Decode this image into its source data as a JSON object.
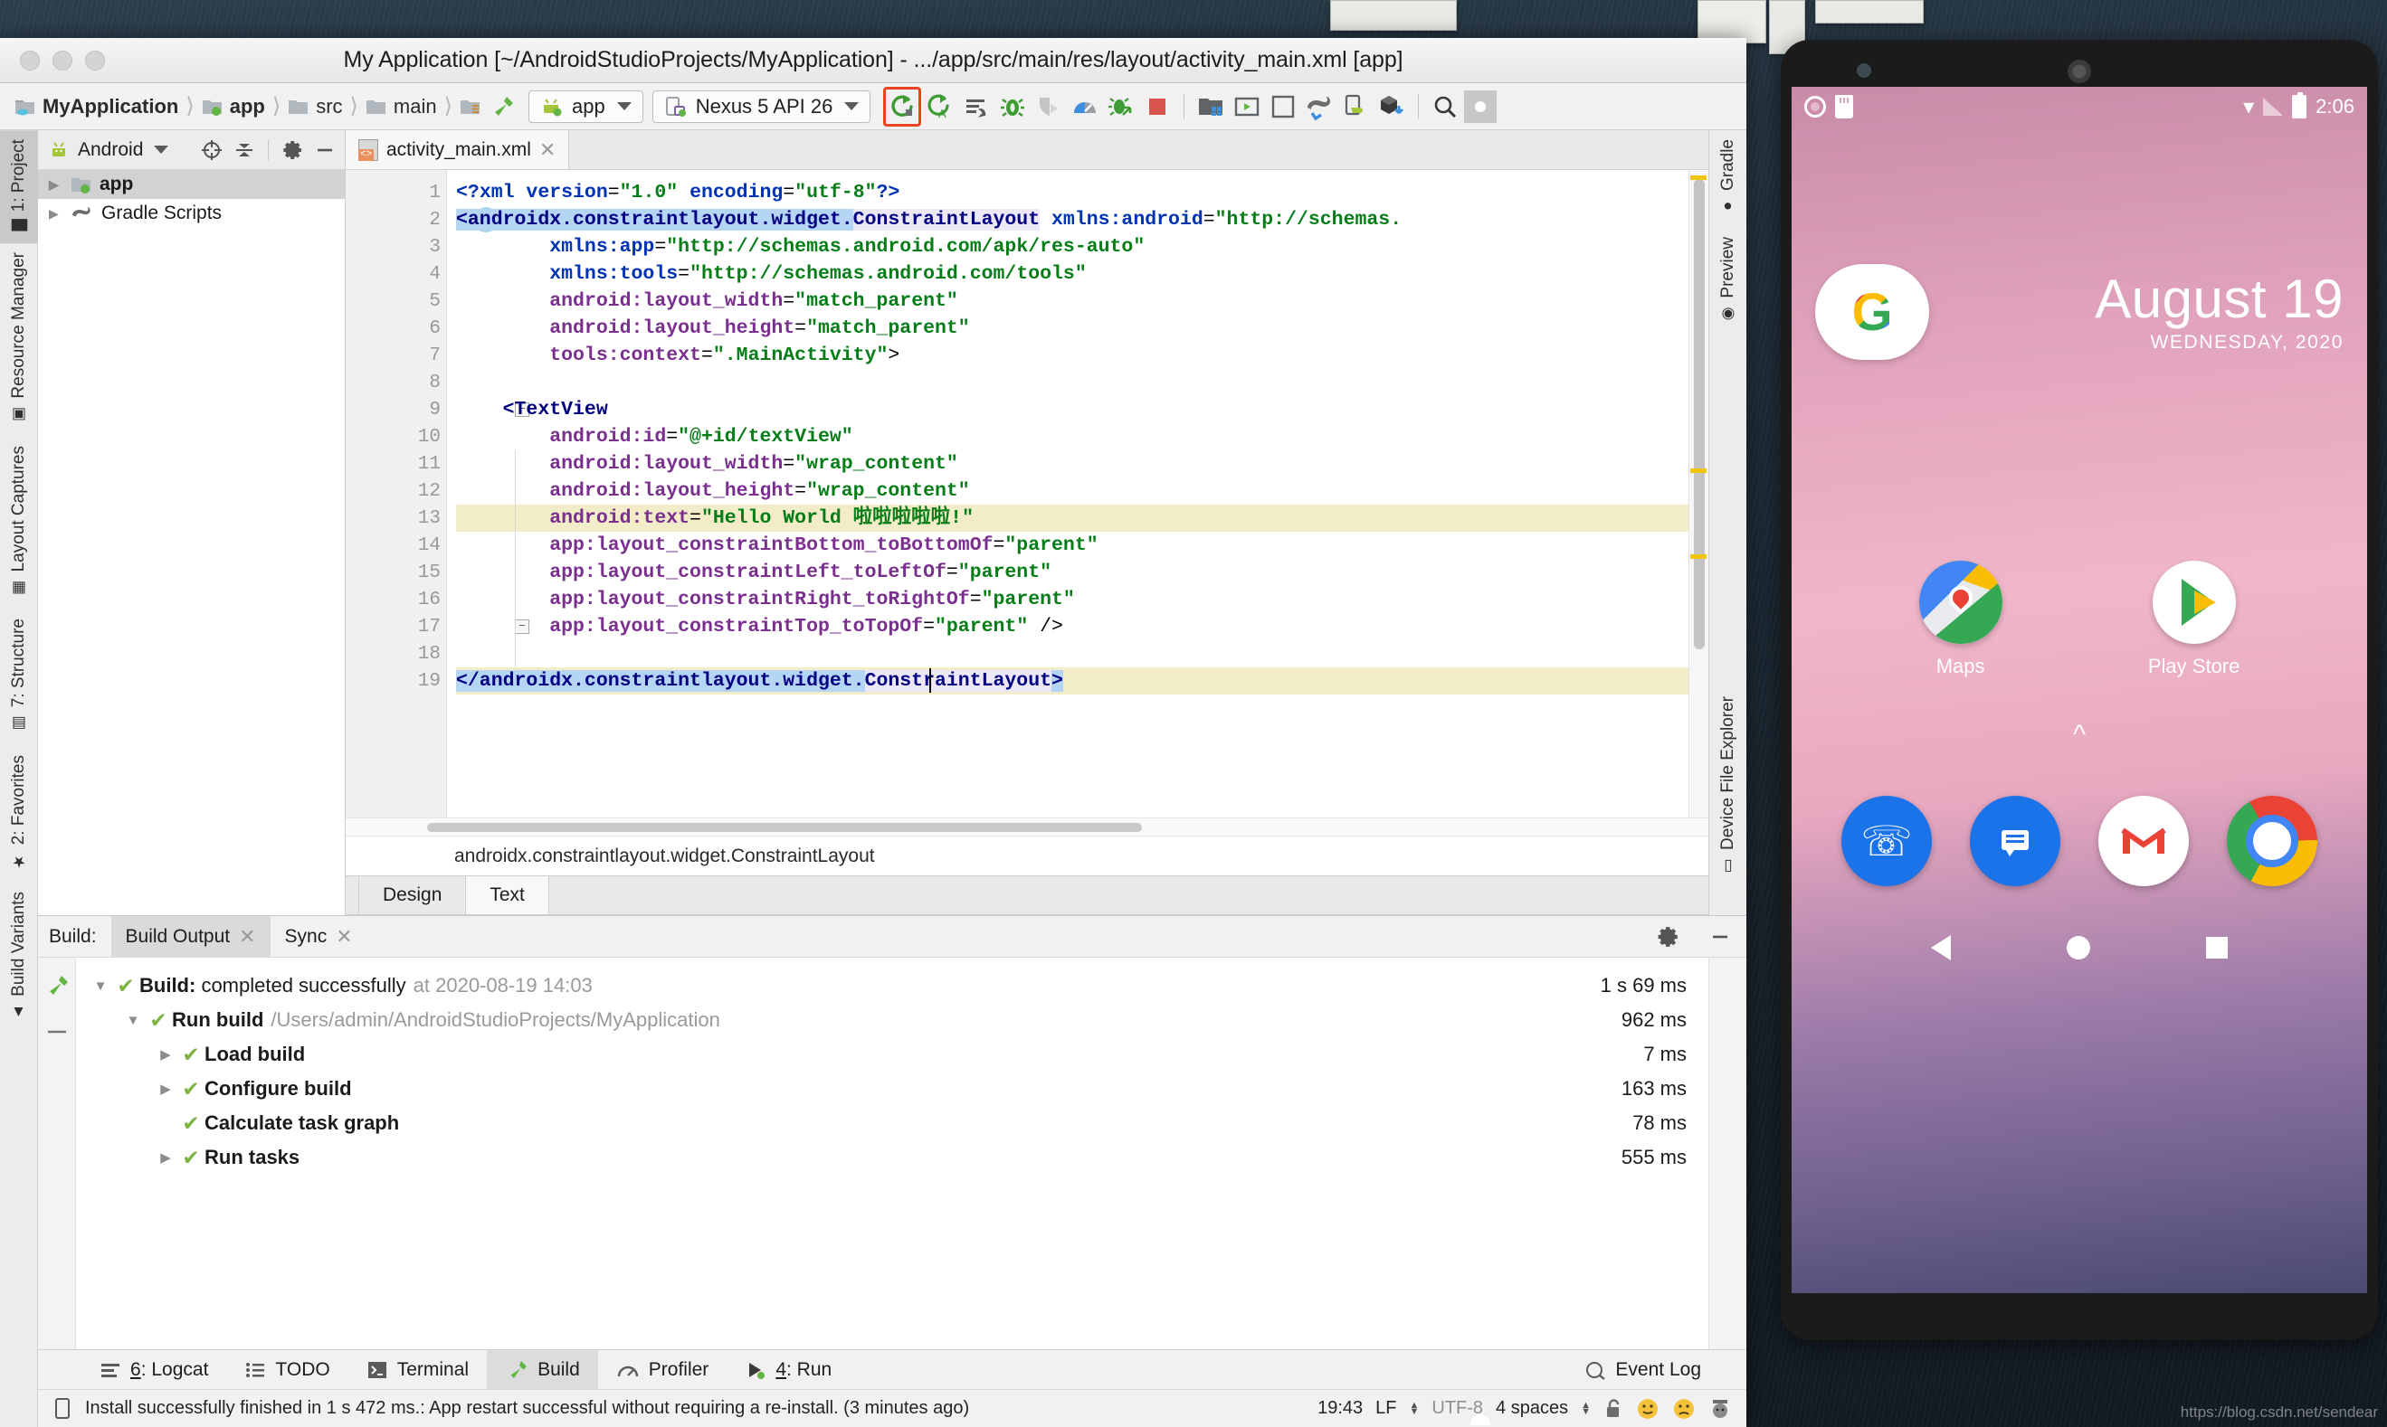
{
  "window": {
    "title": "My Application [~/AndroidStudioProjects/MyApplication] - .../app/src/main/res/layout/activity_main.xml [app]"
  },
  "toolbar": {
    "breadcrumbs": [
      {
        "label": "MyApplication",
        "icon": "module-folder-icon"
      },
      {
        "label": "app",
        "icon": "module-app-icon"
      },
      {
        "label": "src",
        "icon": "folder-icon"
      },
      {
        "label": "main",
        "icon": "folder-icon"
      },
      {
        "label": "",
        "icon": "res-folder-icon"
      }
    ],
    "run_config": {
      "label": "app",
      "icon": "android-head-icon"
    },
    "device": {
      "label": "Nexus 5 API 26",
      "icon": "device-icon"
    },
    "buttons": [
      {
        "name": "run-button",
        "icon": "run-arrow-icon",
        "highlighted": true
      },
      {
        "name": "apply-changes-button",
        "icon": "apply-changes-icon",
        "highlighted": false
      },
      {
        "name": "apply-code-changes-button",
        "icon": "apply-code-changes-icon",
        "highlighted": false
      },
      {
        "name": "debug-button",
        "icon": "bug-icon",
        "highlighted": false
      },
      {
        "name": "attach-debugger-button",
        "icon": "attach-debugger-icon",
        "highlighted": false
      },
      {
        "name": "profiler-button",
        "icon": "profiler-gauge-icon",
        "highlighted": false
      },
      {
        "name": "debug-attach-process-button",
        "icon": "bug-attach-icon",
        "highlighted": false
      },
      {
        "name": "stop-button",
        "icon": "stop-square-icon",
        "highlighted": false
      },
      {
        "name": "sdk-manager-button",
        "icon": "sdk-manager-icon",
        "highlighted": false
      },
      {
        "name": "avd-manager-button",
        "icon": "avd-manager-icon",
        "highlighted": false
      },
      {
        "name": "gradle-sync-button",
        "icon": "gradle-elephant-sync-icon",
        "highlighted": false
      },
      {
        "name": "layout-inspector-button",
        "icon": "layout-inspector-icon",
        "highlighted": false
      },
      {
        "name": "device-file-explorer-button",
        "icon": "cube-download-icon",
        "highlighted": false
      },
      {
        "name": "search-everywhere-button",
        "icon": "search-icon",
        "highlighted": false
      },
      {
        "name": "account-button",
        "icon": "avatar-icon",
        "highlighted": false
      }
    ]
  },
  "left_tool_strip": [
    {
      "label": "1: Project",
      "icon": "android-project-icon",
      "active": true
    },
    {
      "label": "Resource Manager",
      "icon": "resource-manager-icon",
      "active": false
    },
    {
      "label": "Layout Captures",
      "icon": "layout-captures-icon",
      "active": false
    },
    {
      "label": "7: Structure",
      "icon": "structure-icon",
      "active": false
    },
    {
      "label": "2: Favorites",
      "icon": "star-icon",
      "active": false
    },
    {
      "label": "Build Variants",
      "icon": "build-variants-icon",
      "active": false
    }
  ],
  "right_tool_strip": [
    {
      "label": "Gradle",
      "icon": "gradle-elephant-icon"
    },
    {
      "label": "Preview",
      "icon": "eye-icon"
    },
    {
      "label": "Device File Explorer",
      "icon": "device-file-icon"
    }
  ],
  "project_panel": {
    "view_selector": "Android",
    "view_icon": "android-head-icon",
    "header_buttons": [
      {
        "name": "scroll-from-source-button",
        "icon": "target-icon"
      },
      {
        "name": "collapse-all-button",
        "icon": "collapse-all-icon"
      },
      {
        "name": "settings-button",
        "icon": "gear-icon"
      },
      {
        "name": "hide-button",
        "icon": "minus-icon"
      }
    ],
    "tree": [
      {
        "label": "app",
        "icon": "module-app-icon",
        "selected": true,
        "expandable": true
      },
      {
        "label": "Gradle Scripts",
        "icon": "gradle-elephant-icon",
        "selected": false,
        "expandable": true
      }
    ]
  },
  "editor": {
    "tabs": [
      {
        "label": "activity_main.xml",
        "icon": "xml-layout-file-icon",
        "active": true
      }
    ],
    "breadcrumb": "androidx.constraintlayout.widget.ConstraintLayout",
    "mode_tabs": [
      {
        "label": "Design",
        "active": false
      },
      {
        "label": "Text",
        "active": true
      }
    ],
    "gutter_marker_line": 2,
    "gutter_marker_text": "C",
    "lines": [
      {
        "n": 1,
        "tokens": [
          {
            "t": "<?",
            "c": "t-proc"
          },
          {
            "t": "xml ",
            "c": "t-proc"
          },
          {
            "t": "version",
            "c": "t-ns"
          },
          {
            "t": "=",
            "c": "t-eq"
          },
          {
            "t": "\"1.0\"",
            "c": "t-val"
          },
          {
            "t": " ",
            "c": "t-plain"
          },
          {
            "t": "encoding",
            "c": "t-ns"
          },
          {
            "t": "=",
            "c": "t-eq"
          },
          {
            "t": "\"utf-8\"",
            "c": "t-val"
          },
          {
            "t": "?>",
            "c": "t-proc"
          }
        ]
      },
      {
        "n": 2,
        "tokens": [
          {
            "t": "<androidx.constraintlayout.widget.",
            "c": "t-tag",
            "bg": "hl-sel"
          },
          {
            "t": "ConstraintLayout",
            "c": "t-tag",
            "bg": "hl-soft"
          },
          {
            "t": " ",
            "c": "t-plain"
          },
          {
            "t": "xmlns:android",
            "c": "t-ns"
          },
          {
            "t": "=",
            "c": "t-eq"
          },
          {
            "t": "\"http://schemas.",
            "c": "t-val"
          }
        ]
      },
      {
        "n": 3,
        "indent": 4,
        "tokens": [
          {
            "t": "xmlns:app",
            "c": "t-ns"
          },
          {
            "t": "=",
            "c": "t-eq"
          },
          {
            "t": "\"http://schemas.android.com/apk/res-auto\"",
            "c": "t-val"
          }
        ]
      },
      {
        "n": 4,
        "indent": 4,
        "tokens": [
          {
            "t": "xmlns:tools",
            "c": "t-ns"
          },
          {
            "t": "=",
            "c": "t-eq"
          },
          {
            "t": "\"http://schemas.android.com/tools\"",
            "c": "t-val"
          }
        ]
      },
      {
        "n": 5,
        "indent": 4,
        "tokens": [
          {
            "t": "android:layout_width",
            "c": "t-attr"
          },
          {
            "t": "=",
            "c": "t-eq"
          },
          {
            "t": "\"match_parent\"",
            "c": "t-val"
          }
        ]
      },
      {
        "n": 6,
        "indent": 4,
        "tokens": [
          {
            "t": "android:layout_height",
            "c": "t-attr"
          },
          {
            "t": "=",
            "c": "t-eq"
          },
          {
            "t": "\"match_parent\"",
            "c": "t-val"
          }
        ]
      },
      {
        "n": 7,
        "indent": 4,
        "tokens": [
          {
            "t": "tools:context",
            "c": "t-attr"
          },
          {
            "t": "=",
            "c": "t-eq"
          },
          {
            "t": "\".MainActivity\"",
            "c": "t-val"
          },
          {
            "t": ">",
            "c": "t-plain"
          }
        ]
      },
      {
        "n": 8,
        "indent": 0,
        "tokens": []
      },
      {
        "n": 9,
        "indent": 2,
        "tokens": [
          {
            "t": "<TextView",
            "c": "t-tag"
          }
        ]
      },
      {
        "n": 10,
        "indent": 4,
        "tokens": [
          {
            "t": "android:id",
            "c": "t-attr"
          },
          {
            "t": "=",
            "c": "t-eq"
          },
          {
            "t": "\"@+id/textView\"",
            "c": "t-val"
          }
        ]
      },
      {
        "n": 11,
        "indent": 4,
        "tokens": [
          {
            "t": "android:layout_width",
            "c": "t-attr"
          },
          {
            "t": "=",
            "c": "t-eq"
          },
          {
            "t": "\"wrap_content\"",
            "c": "t-val"
          }
        ]
      },
      {
        "n": 12,
        "indent": 4,
        "tokens": [
          {
            "t": "android:layout_height",
            "c": "t-attr"
          },
          {
            "t": "=",
            "c": "t-eq"
          },
          {
            "t": "\"wrap_content\"",
            "c": "t-val"
          }
        ]
      },
      {
        "n": 13,
        "indent": 4,
        "highlight_line": "hl-yel",
        "tokens": [
          {
            "t": "android:text",
            "c": "t-attr"
          },
          {
            "t": "=",
            "c": "t-eq"
          },
          {
            "t": "\"Hello World 啦啦啦啦啦!\"",
            "c": "t-val"
          }
        ]
      },
      {
        "n": 14,
        "indent": 4,
        "tokens": [
          {
            "t": "app:layout_constraintBottom_toBottomOf",
            "c": "t-attr"
          },
          {
            "t": "=",
            "c": "t-eq"
          },
          {
            "t": "\"parent\"",
            "c": "t-val"
          }
        ]
      },
      {
        "n": 15,
        "indent": 4,
        "tokens": [
          {
            "t": "app:layout_constraintLeft_toLeftOf",
            "c": "t-attr"
          },
          {
            "t": "=",
            "c": "t-eq"
          },
          {
            "t": "\"parent\"",
            "c": "t-val"
          }
        ]
      },
      {
        "n": 16,
        "indent": 4,
        "tokens": [
          {
            "t": "app:layout_constraintRight_toRightOf",
            "c": "t-attr"
          },
          {
            "t": "=",
            "c": "t-eq"
          },
          {
            "t": "\"parent\"",
            "c": "t-val"
          }
        ]
      },
      {
        "n": 17,
        "indent": 4,
        "tokens": [
          {
            "t": "app:layout_constraintTop_toTopOf",
            "c": "t-attr"
          },
          {
            "t": "=",
            "c": "t-eq"
          },
          {
            "t": "\"parent\"",
            "c": "t-val"
          },
          {
            "t": " />",
            "c": "t-plain"
          }
        ]
      },
      {
        "n": 18,
        "indent": 0,
        "tokens": []
      },
      {
        "n": 19,
        "indent": 0,
        "highlight_line": "hl-yel",
        "tokens": [
          {
            "t": "</androidx.constraintlayout.widget.",
            "c": "t-tag",
            "bg": "hl-sel"
          },
          {
            "t": "ConstraintLayout",
            "c": "t-tag",
            "bg": "hl-soft"
          },
          {
            "t": ">",
            "c": "t-tag",
            "bg": "hl-sel"
          }
        ]
      }
    ]
  },
  "build_panel": {
    "label": "Build:",
    "tabs": [
      {
        "label": "Build Output",
        "active": true,
        "closeable": true
      },
      {
        "label": "Sync",
        "active": false,
        "closeable": true
      }
    ],
    "header_buttons": [
      {
        "name": "build-settings-button",
        "icon": "gear-icon"
      },
      {
        "name": "build-hide-button",
        "icon": "minus-icon"
      }
    ],
    "side_buttons": [
      {
        "name": "build-toggle-button",
        "icon": "hammer-icon"
      },
      {
        "name": "build-restart-button",
        "icon": "restart-icon"
      }
    ],
    "rows": [
      {
        "indent": 0,
        "tri": "▼",
        "name": "Build:",
        "rest": "completed successfully",
        "dim": "at 2020-08-19 14:03",
        "time": "1 s 69 ms"
      },
      {
        "indent": 1,
        "tri": "▼",
        "name": "Run build",
        "rest": "",
        "dim": "/Users/admin/AndroidStudioProjects/MyApplication",
        "time": "962 ms"
      },
      {
        "indent": 2,
        "tri": "▶",
        "name": "Load build",
        "rest": "",
        "dim": "",
        "time": "7 ms"
      },
      {
        "indent": 2,
        "tri": "▶",
        "name": "Configure build",
        "rest": "",
        "dim": "",
        "time": "163 ms"
      },
      {
        "indent": 2,
        "tri": "",
        "name": "Calculate task graph",
        "rest": "",
        "dim": "",
        "time": "78 ms"
      },
      {
        "indent": 2,
        "tri": "▶",
        "name": "Run tasks",
        "rest": "",
        "dim": "",
        "time": "555 ms"
      }
    ]
  },
  "bottom_tool_buttons": [
    {
      "label": "6: Logcat",
      "icon": "logcat-icon",
      "active": false,
      "mnemonic": "6"
    },
    {
      "label": "TODO",
      "icon": "todo-list-icon",
      "active": false,
      "mnemonic": ""
    },
    {
      "label": "Terminal",
      "icon": "terminal-icon",
      "active": false,
      "mnemonic": ""
    },
    {
      "label": "Build",
      "icon": "hammer-icon",
      "active": true,
      "mnemonic": ""
    },
    {
      "label": "Profiler",
      "icon": "profiler-gauge-icon",
      "active": false,
      "mnemonic": ""
    },
    {
      "label": "4: Run",
      "icon": "run-arrow-icon",
      "active": false,
      "mnemonic": "4"
    },
    {
      "label": "Event Log",
      "icon": "event-log-icon",
      "active": false,
      "mnemonic": ""
    }
  ],
  "status_bar": {
    "message_icon": "device-icon",
    "message": "Install successfully finished in 1 s 472 ms.: App restart successful without requiring a re-install. (3 minutes ago)",
    "caret_position": "19:43",
    "line_separator": "LF",
    "encoding": "UTF-8",
    "indent": "4 spaces",
    "lock_icon": "unlocked-padlock-icon",
    "feedback_icons": [
      "happy-face-icon",
      "sad-face-icon",
      "hector-icon"
    ]
  },
  "emulator": {
    "device_name": "Nexus 5 API 26",
    "status_bar": {
      "left_icons": [
        "ring-icon",
        "sd-card-icon"
      ],
      "wifi_icon": "wifi-no-internet-icon",
      "signal_icon": "cell-signal-icon",
      "battery_icon": "battery-full-icon",
      "clock": "2:06"
    },
    "widget": {
      "search_icon": "google-g-icon",
      "date_big": "August 19",
      "date_small": "WEDNESDAY, 2020"
    },
    "apps": [
      {
        "label": "Maps",
        "icon": "google-maps-icon"
      },
      {
        "label": "Play Store",
        "icon": "google-play-icon"
      }
    ],
    "app_drawer_icon": "chevron-up-icon",
    "dock": [
      {
        "name": "phone-app-icon",
        "glyph": "✆"
      },
      {
        "name": "messages-app-icon",
        "glyph": "☰"
      },
      {
        "name": "gmail-app-icon",
        "glyph": "M"
      },
      {
        "name": "chrome-app-icon",
        "glyph": ""
      }
    ],
    "nav_bar": [
      {
        "name": "nav-back-button"
      },
      {
        "name": "nav-home-button"
      },
      {
        "name": "nav-recents-button"
      }
    ]
  },
  "watermark": "https://blog.csdn.net/sendear",
  "colors": {
    "accent_orange": "#e8441d",
    "green": "#4a9c3d",
    "check_green": "#7cb342",
    "stop_red": "#d9534f",
    "selection_blue": "#b5d5f5",
    "highlight_yellow": "#f2edc8"
  }
}
